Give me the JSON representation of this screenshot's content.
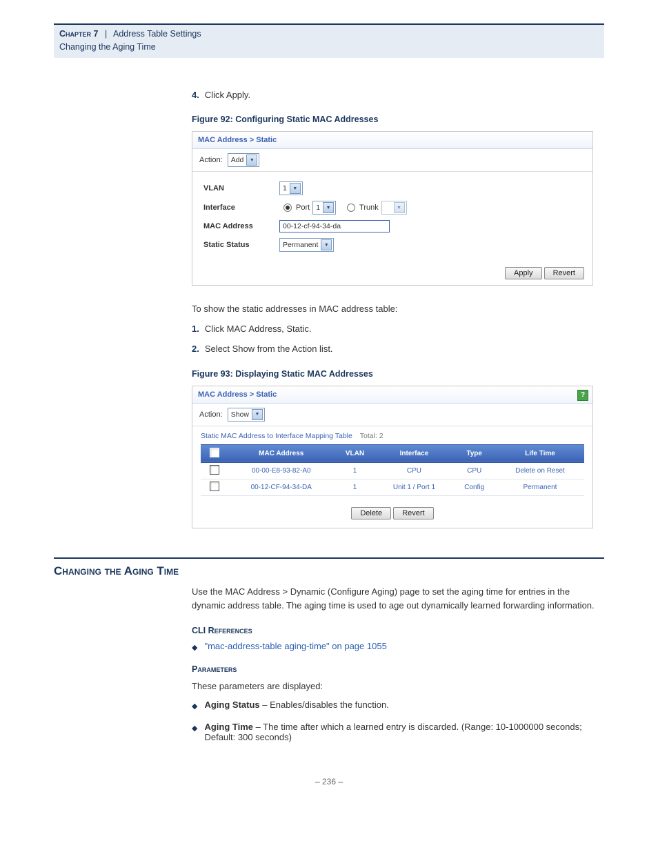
{
  "header": {
    "chapter": "Chapter 7",
    "title": "Address Table Settings",
    "subtitle": "Changing the Aging Time"
  },
  "step4": {
    "num": "4.",
    "text": "Click Apply."
  },
  "fig92": {
    "caption": "Figure 92:  Configuring Static MAC Addresses",
    "panelTitle": "MAC Address > Static",
    "actionLabel": "Action:",
    "actionValue": "Add",
    "rows": {
      "vlan": {
        "label": "VLAN",
        "value": "1"
      },
      "interface": {
        "label": "Interface",
        "portLabel": "Port",
        "portValue": "1",
        "trunkLabel": "Trunk"
      },
      "mac": {
        "label": "MAC Address",
        "value": "00-12-cf-94-34-da"
      },
      "status": {
        "label": "Static Status",
        "value": "Permanent"
      }
    },
    "buttons": {
      "apply": "Apply",
      "revert": "Revert"
    }
  },
  "introShow": "To show the static addresses in MAC address table:",
  "step1": {
    "num": "1.",
    "text": "Click MAC Address, Static."
  },
  "step2": {
    "num": "2.",
    "text": "Select Show from the Action list."
  },
  "fig93": {
    "caption": "Figure 93:  Displaying Static MAC Addresses",
    "panelTitle": "MAC Address > Static",
    "actionLabel": "Action:",
    "actionValue": "Show",
    "tableCaption": "Static MAC Address to Interface Mapping Table",
    "totalLabel": "Total: 2",
    "headers": [
      "",
      "MAC Address",
      "VLAN",
      "Interface",
      "Type",
      "Life Time"
    ],
    "rows": [
      {
        "mac": "00-00-E8-93-82-A0",
        "vlan": "1",
        "intf": "CPU",
        "type": "CPU",
        "life": "Delete on Reset"
      },
      {
        "mac": "00-12-CF-94-34-DA",
        "vlan": "1",
        "intf": "Unit 1 / Port 1",
        "type": "Config",
        "life": "Permanent"
      }
    ],
    "buttons": {
      "delete": "Delete",
      "revert": "Revert"
    }
  },
  "section": {
    "title": "Changing the Aging Time",
    "intro": "Use the MAC Address > Dynamic (Configure Aging) page to set the aging time for entries in the dynamic address table. The aging time is used to age out dynamically learned forwarding information.",
    "cliTitle": "CLI References",
    "cliLink": "\"mac-address-table aging-time\" on page 1055",
    "paramTitle": "Parameters",
    "paramIntro": "These parameters are displayed:",
    "p1label": "Aging Status",
    "p1desc": " – Enables/disables the function.",
    "p2label": "Aging Time",
    "p2desc": " – The time after which a learned entry is discarded. (Range: 10-1000000 seconds; Default: 300 seconds)"
  },
  "footer": "–  236  –"
}
